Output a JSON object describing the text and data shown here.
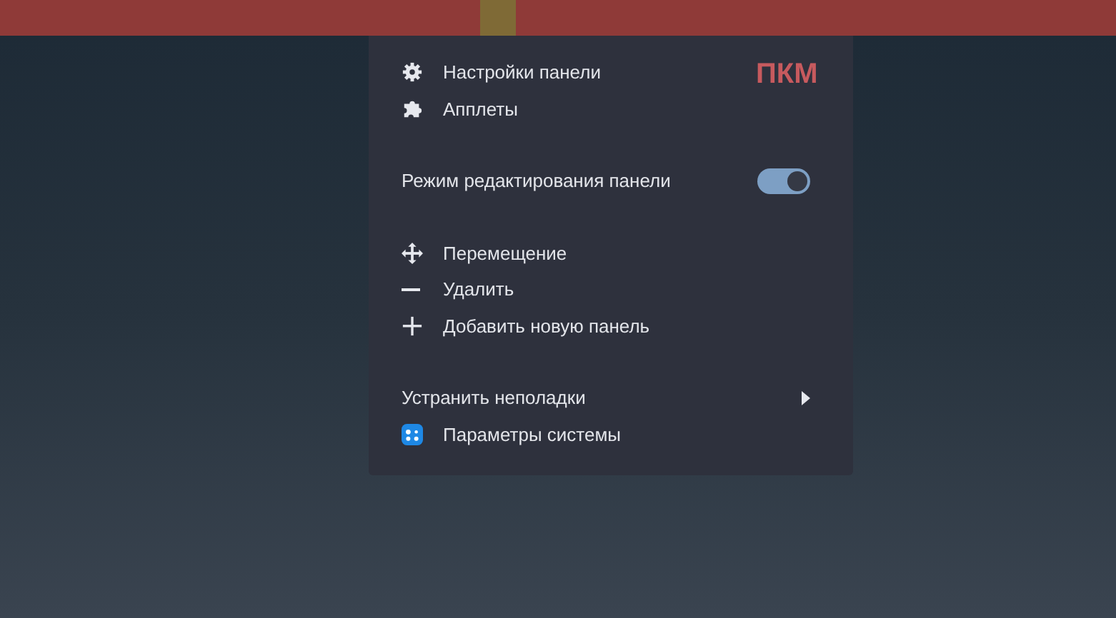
{
  "panel": {
    "highlight": true
  },
  "context_menu": {
    "annotation": "ПКМ",
    "groups": [
      [
        {
          "kind": "action",
          "label": "Настройки панели"
        },
        {
          "kind": "action",
          "label": "Апплеты"
        }
      ],
      [
        {
          "kind": "toggle",
          "label": "Режим редактирования панели",
          "on": true
        }
      ],
      [
        {
          "kind": "action",
          "label": "Перемещение"
        },
        {
          "kind": "action",
          "label": "Удалить"
        },
        {
          "kind": "action",
          "label": "Добавить новую панель"
        }
      ],
      [
        {
          "kind": "submenu",
          "label": "Устранить неполадки"
        },
        {
          "kind": "action",
          "label": "Параметры системы"
        }
      ]
    ]
  }
}
